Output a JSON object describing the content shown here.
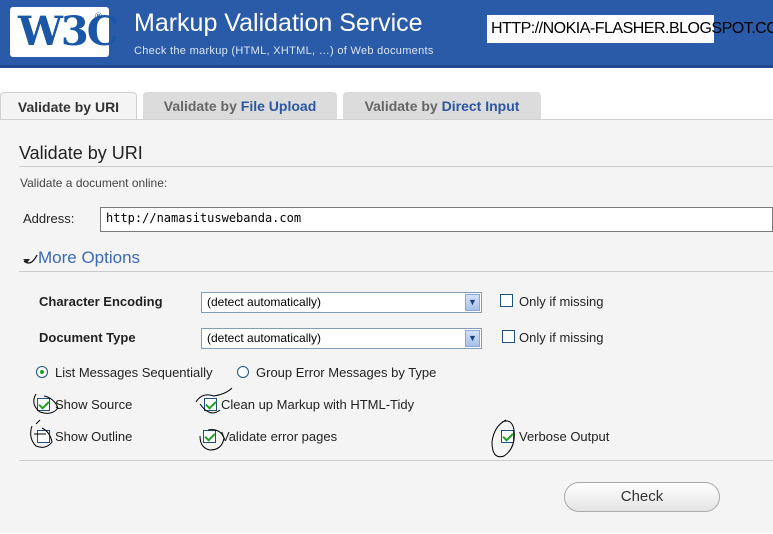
{
  "header": {
    "logo_text": "W3C",
    "logo_reg": "®",
    "title": "Markup Validation Service",
    "subtitle": "Check the markup (HTML, XHTML, …) of Web documents",
    "watermark": "HTTP://NOKIA-FLASHER.BLOGSPOT.COM"
  },
  "tabs": [
    {
      "prefix": "Validate by ",
      "emph": "URI"
    },
    {
      "prefix": "Validate by ",
      "emph": "File Upload"
    },
    {
      "prefix": "Validate by ",
      "emph": "Direct Input"
    }
  ],
  "panel": {
    "title": "Validate by URI",
    "description": "Validate a document online:",
    "address_label": "Address:",
    "address_value": "http://namasituswebanda.com"
  },
  "options": {
    "more_label": "More Options",
    "char_encoding_label": "Character Encoding",
    "char_encoding_value": "(detect automatically)",
    "doctype_label": "Document Type",
    "doctype_value": "(detect automatically)",
    "only_if_missing": "Only if missing",
    "list_sequential": "List Messages Sequentially",
    "group_by_type": "Group Error Messages by Type",
    "show_source": "Show Source",
    "cleanup": "Clean up Markup with HTML-Tidy",
    "show_outline": "Show Outline",
    "validate_error_pages": "Validate error pages",
    "verbose_output": "Verbose Output"
  },
  "check_button": "Check",
  "colors": {
    "header_bg": "#2a5ba8",
    "accent_blue": "#3b6bb3",
    "check_green": "#21a121"
  }
}
